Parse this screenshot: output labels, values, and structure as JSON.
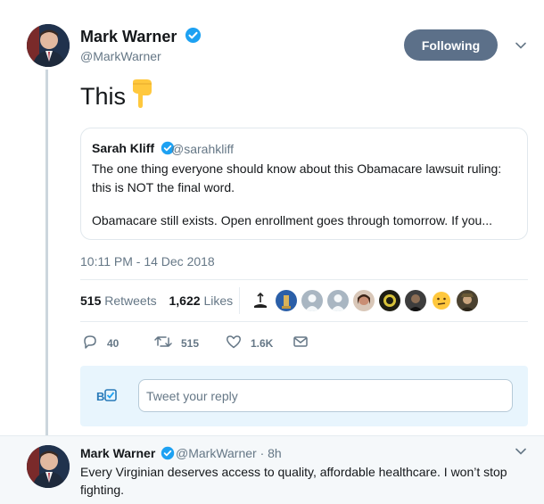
{
  "tweet": {
    "author_name": "Mark Warner",
    "author_handle": "@MarkWarner",
    "follow_label": "Following",
    "text": "This",
    "timestamp": "10:11 PM - 14 Dec 2018",
    "retweets_count": "515",
    "retweets_label": "Retweets",
    "likes_count": "1,622",
    "likes_label": "Likes"
  },
  "quote": {
    "author_name": "Sarah Kliff",
    "author_handle": "@sarahkliff",
    "line1": "The one thing everyone should know about this Obamacare lawsuit ruling:",
    "line2": "this is NOT the final word.",
    "line3": "Obamacare still exists. Open enrollment goes through tomorrow. If you..."
  },
  "actions": {
    "reply_count": "40",
    "retweet_count": "515",
    "like_count": "1.6K"
  },
  "reply_box": {
    "placeholder": "Tweet your reply"
  },
  "reply_tweet": {
    "author_name": "Mark Warner",
    "meta": "@MarkWarner · 8h",
    "text": "Every Virginian deserves access to quality, affordable healthcare. I won’t stop fighting."
  },
  "colors": {
    "brand_blue": "#1da1f2",
    "following_button": "#5c7089",
    "secondary_text": "#657786",
    "reply_box_bg": "#e8f5fd"
  }
}
